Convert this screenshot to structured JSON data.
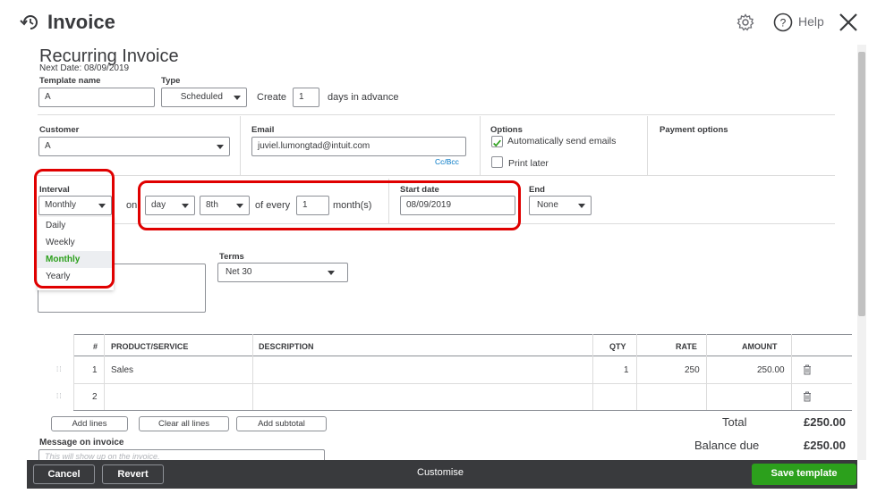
{
  "header": {
    "title": "Invoice",
    "help": "Help"
  },
  "form": {
    "heading": "Recurring Invoice",
    "next_date": "Next Date: 08/09/2019",
    "template_name_label": "Template name",
    "template_name_value": "A",
    "type_label": "Type",
    "type_value": "Scheduled",
    "create_label": "Create",
    "create_value": "1",
    "days_in_advance": "days in advance",
    "customer_label": "Customer",
    "customer_value": "A",
    "email_label": "Email",
    "email_value": "juviel.lumongtad@intuit.com",
    "cc_bcc": "Cc/Bcc",
    "options_label": "Options",
    "auto_send": "Automatically send emails",
    "auto_send_checked": true,
    "print_later": "Print later",
    "print_later_checked": false,
    "payment_options_label": "Payment options",
    "interval_label": "Interval",
    "interval_value": "Monthly",
    "on_label": "on",
    "on_day_value": "day",
    "on_nth_value": "8th",
    "of_every_label": "of every",
    "every_value": "1",
    "months_label": "month(s)",
    "start_date_label": "Start date",
    "start_date_value": "08/09/2019",
    "end_label": "End",
    "end_value": "None",
    "terms_label": "Terms",
    "terms_value": "Net 30",
    "interval_options": [
      "Daily",
      "Weekly",
      "Monthly",
      "Yearly"
    ],
    "interval_selected": "Monthly"
  },
  "table": {
    "headers": {
      "num": "#",
      "product": "PRODUCT/SERVICE",
      "description": "DESCRIPTION",
      "qty": "QTY",
      "rate": "RATE",
      "amount": "AMOUNT"
    },
    "rows": [
      {
        "num": "1",
        "product": "Sales",
        "description": "",
        "qty": "1",
        "rate": "250",
        "amount": "250.00"
      },
      {
        "num": "2",
        "product": "",
        "description": "",
        "qty": "",
        "rate": "",
        "amount": ""
      }
    ]
  },
  "actions": {
    "add_lines": "Add lines",
    "clear_all_lines": "Clear all lines",
    "add_subtotal": "Add subtotal"
  },
  "message": {
    "label": "Message on invoice",
    "placeholder": "This will show up on the invoice."
  },
  "totals": {
    "total_label": "Total",
    "total_value": "£250.00",
    "balance_label": "Balance due",
    "balance_value": "£250.00"
  },
  "footer": {
    "cancel": "Cancel",
    "revert": "Revert",
    "customise": "Customise",
    "save_template": "Save template"
  },
  "colors": {
    "brand_green": "#2ca01c",
    "footer_bg": "#393a3d",
    "highlight_red": "#e00000"
  }
}
